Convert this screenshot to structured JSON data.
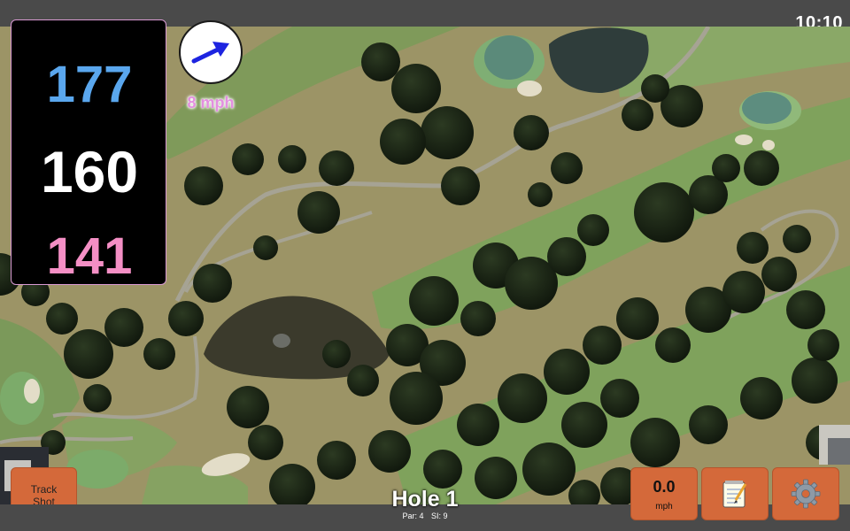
{
  "status_bar": {
    "time": "10:10"
  },
  "distances": {
    "back": "177",
    "middle": "160",
    "front": "141"
  },
  "wind": {
    "direction_icon": "arrow-right-icon",
    "speed_label": "8 mph"
  },
  "hole": {
    "title": "Hole 1",
    "par": "Par: 4",
    "stroke_index": "SI: 9"
  },
  "buttons": {
    "track_shot_line1": "Track",
    "track_shot_line2": "Shot",
    "wind_value": "0.0",
    "wind_unit": "mph",
    "notes_icon": "notepad-icon",
    "settings_icon": "gear-icon"
  },
  "colors": {
    "back": "#5aa7ee",
    "middle": "#ffffff",
    "front": "#f48fc5",
    "button": "#d4693a",
    "wind_label": "#e38fe0"
  }
}
